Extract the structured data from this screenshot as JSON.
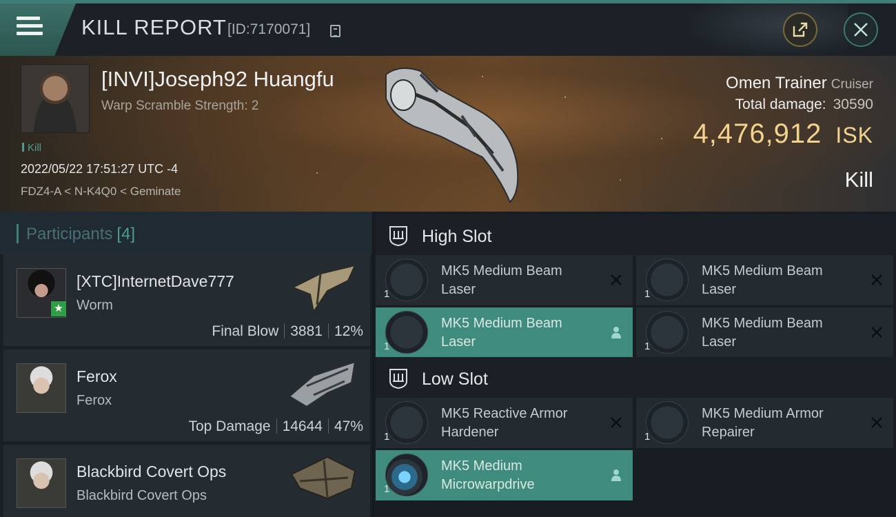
{
  "header": {
    "title": "KILL REPORT",
    "id_text": "[ID:7170071]"
  },
  "victim": {
    "name": "[INVI]Joseph92 Huangfu",
    "warp_scramble": "Warp Scramble Strength: 2",
    "tag": "Kill",
    "datetime": "2022/05/22 17:51:27 UTC -4",
    "location": "FDZ4-A < N-K4Q0 < Geminate",
    "ship_name": "Omen Trainer",
    "ship_class": "Cruiser",
    "total_damage_label": "Total damage:",
    "total_damage_value": "30590",
    "isk_value": "4,476,912",
    "isk_unit": "ISK",
    "result": "Kill"
  },
  "participants": {
    "title": "Participants",
    "count": "[4]",
    "items": [
      {
        "name": "[XTC]InternetDave777",
        "ship": "Worm",
        "stat_label": "Final Blow",
        "damage": "3881",
        "percent": "12%"
      },
      {
        "name": "Ferox",
        "ship": "Ferox",
        "stat_label": "Top Damage",
        "damage": "14644",
        "percent": "47%"
      },
      {
        "name": "Blackbird Covert Ops",
        "ship": "Blackbird Covert Ops",
        "stat_label": "",
        "damage": "",
        "percent": ""
      }
    ]
  },
  "fitting": {
    "high_slot": {
      "title": "High Slot",
      "modules": [
        {
          "name": "MK5 Medium Beam Laser",
          "qty": "1",
          "status": "destroyed"
        },
        {
          "name": "MK5 Medium Beam Laser",
          "qty": "1",
          "status": "destroyed"
        },
        {
          "name": "MK5 Medium Beam Laser",
          "qty": "1",
          "status": "dropped"
        },
        {
          "name": "MK5 Medium Beam Laser",
          "qty": "1",
          "status": "destroyed"
        }
      ]
    },
    "low_slot": {
      "title": "Low Slot",
      "modules": [
        {
          "name": "MK5 Reactive Armor Hardener",
          "qty": "1",
          "status": "destroyed"
        },
        {
          "name": "MK5 Medium Armor Repairer",
          "qty": "1",
          "status": "destroyed"
        },
        {
          "name": "MK5 Medium Microwarpdrive",
          "qty": "1",
          "status": "dropped"
        }
      ]
    }
  },
  "colors": {
    "accent": "#3f8b7e",
    "isk": "#f2d38d",
    "header": "#1b2127"
  }
}
